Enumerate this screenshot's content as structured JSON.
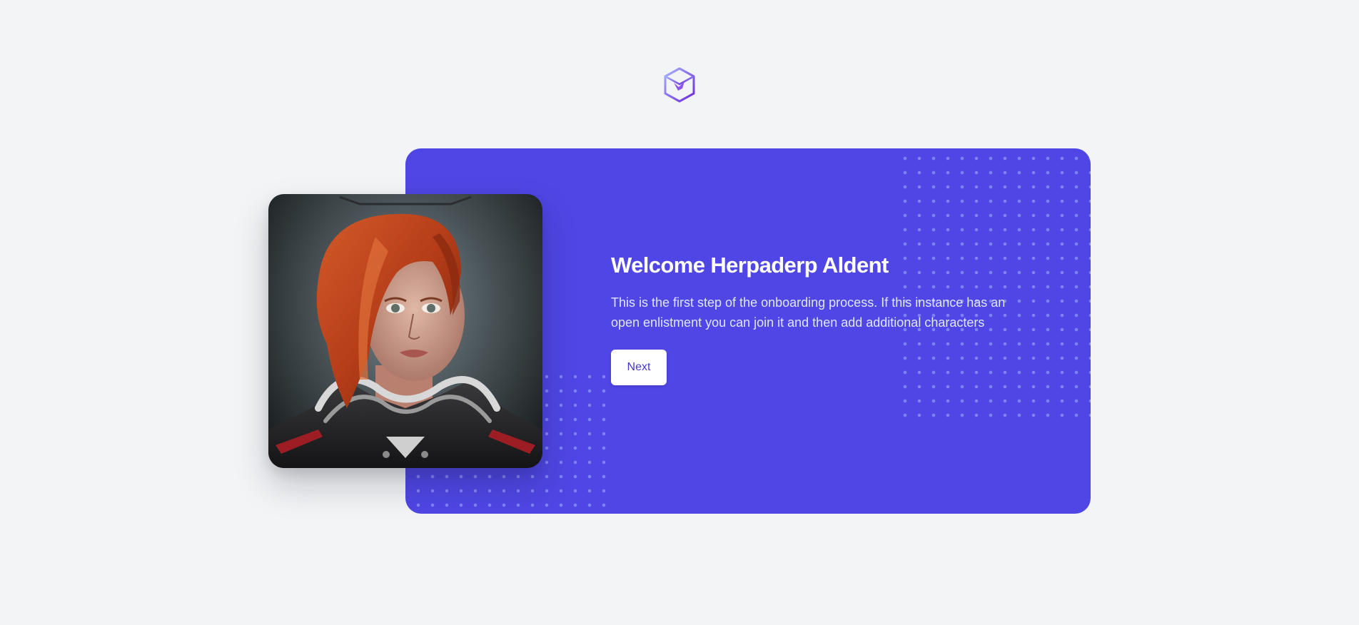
{
  "brand": {
    "logo_icon": "cube-logo-icon",
    "accent_color": "#4f46e5"
  },
  "welcome": {
    "title": "Welcome Herpaderp Aldent",
    "description": "This is the first step of the onboarding process. If this instance has an open enlistment you can join it and then add additional characters",
    "next_label": "Next"
  },
  "portrait": {
    "icon": "character-portrait"
  }
}
